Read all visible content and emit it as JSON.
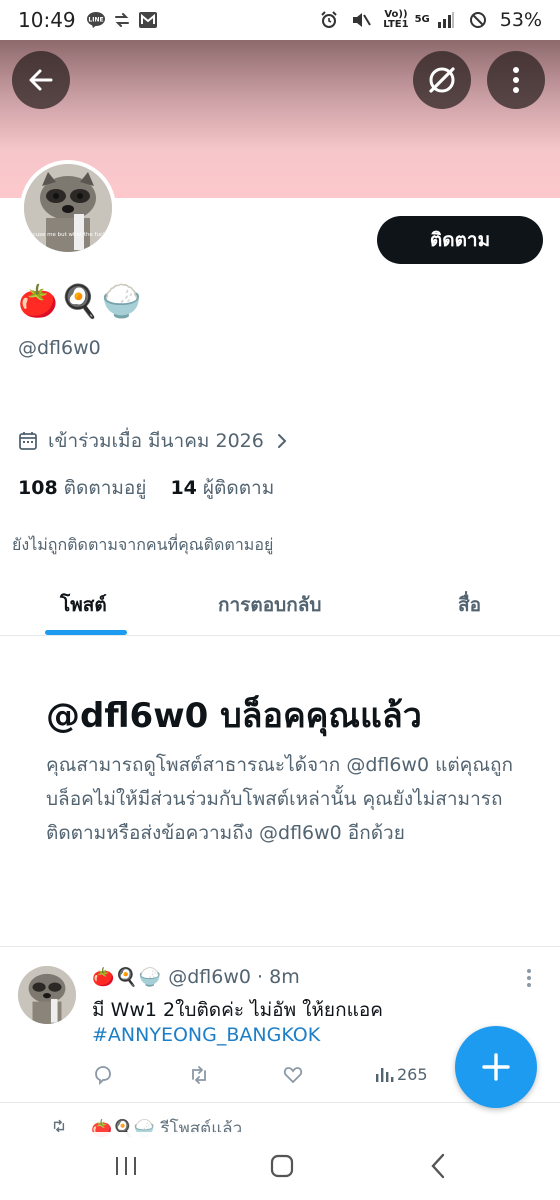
{
  "status_bar": {
    "time": "10:49",
    "net_label_top": "Vo))",
    "net_label_bottom": "LTE1",
    "net_5g": "5G",
    "battery": "53%"
  },
  "header": {
    "back_icon": "arrow-left-icon",
    "grok_icon": "grok-icon",
    "more_icon": "more-vertical-icon",
    "banner_color": "#fdc8cc"
  },
  "profile": {
    "avatar_text": "scuse me but what the fuck",
    "follow_label": "ติดตาม",
    "display_name": "🍅🍳🍚",
    "handle": "@dfl6w0",
    "joined": "เข้าร่วมเมื่อ มีนาคม 2026",
    "following_count": "108",
    "following_label": "ติดตามอยู่",
    "followers_count": "14",
    "followers_label": "ผู้ติดตาม",
    "not_followed_text": "ยังไม่ถูกติดตามจากคนที่คุณติดตามอยู่"
  },
  "tabs": [
    {
      "label": "โพสต์"
    },
    {
      "label": "การตอบกลับ"
    },
    {
      "label": "สื่อ"
    }
  ],
  "blocked": {
    "title": "@dfl6w0 บล็อคคุณแล้ว",
    "description": "คุณสามารถดูโพสต์สาธารณะได้จาก @dfl6w0 แต่คุณถูกบล็อคไม่ให้มีส่วนร่วมกับโพสต์เหล่านั้น คุณยังไม่สามารถติดตามหรือส่งข้อความถึง @dfl6w0 อีกด้วย"
  },
  "post": {
    "display_name": "🍅🍳🍚",
    "handle": "@dfl6w0",
    "separator": "·",
    "time": "8m",
    "text": "มี Ww1 2ใบติดค่ะ ไม่อัพ ให้ยกแอค",
    "hashtag": "#ANNYEONG_BANGKOK",
    "views": "265"
  },
  "repost_row": {
    "emoji": "🍅🍳🍚",
    "text": "รีโพสต์แล้ว"
  },
  "colors": {
    "accent": "#1d9bf0",
    "follow_button": "#0f1419",
    "muted_text": "#536471"
  }
}
